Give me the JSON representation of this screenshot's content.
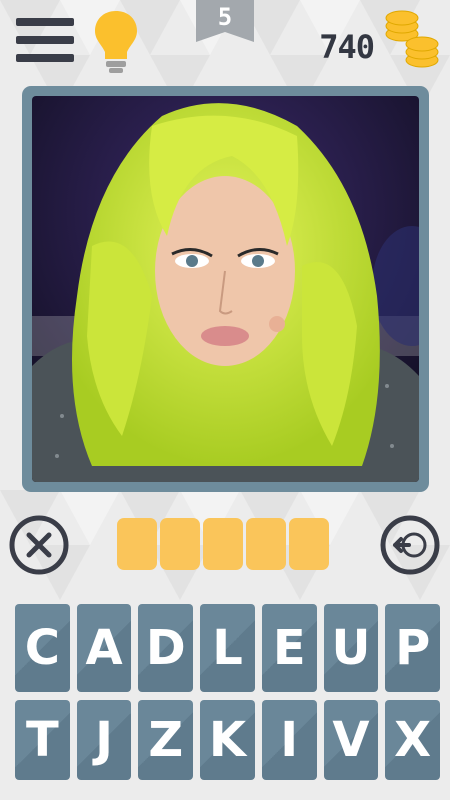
{
  "header": {
    "level": "5",
    "coins": "740",
    "menu_icon": "hamburger-menu-icon",
    "hint_icon": "lightbulb-icon",
    "coins_icon": "coin-stack-icon"
  },
  "puzzle": {
    "photo": "woman-with-neon-green-wavy-hair",
    "answer_length": 5,
    "slot_color": "#fac55a"
  },
  "controls": {
    "clear_icon": "close-icon",
    "backspace_icon": "arrow-left-icon"
  },
  "keyboard": {
    "rows": [
      [
        "C",
        "A",
        "D",
        "L",
        "E",
        "U",
        "P"
      ],
      [
        "T",
        "J",
        "Z",
        "K",
        "I",
        "V",
        "X"
      ]
    ],
    "key_color": "#6a8799"
  },
  "colors": {
    "background": "#ededed",
    "frame": "#6e8c9c",
    "accent": "#fac55a",
    "dark": "#333742"
  }
}
